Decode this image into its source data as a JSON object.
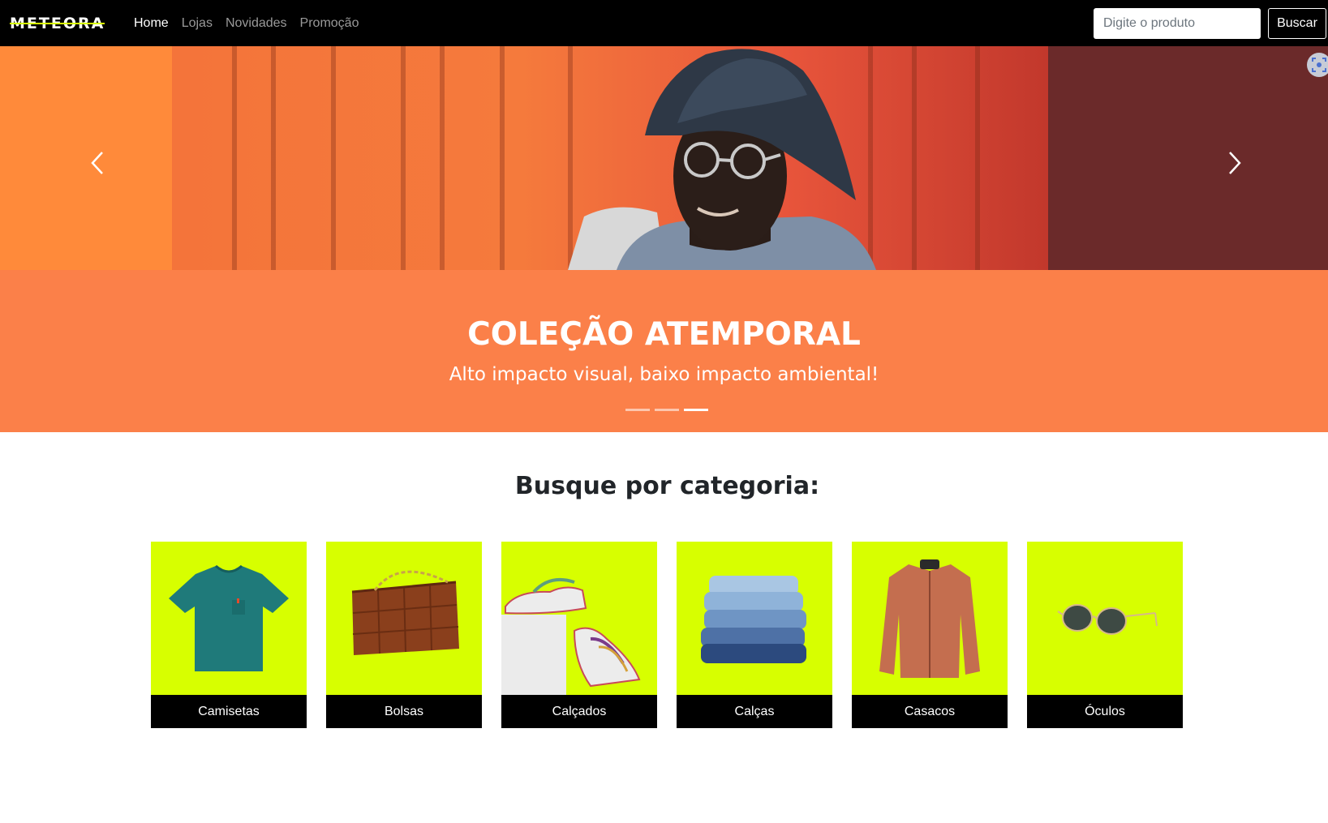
{
  "brand": {
    "logo_text": "METEORA",
    "accent_color": "#d7ff00"
  },
  "nav": {
    "links": [
      {
        "label": "Home",
        "active": true
      },
      {
        "label": "Lojas",
        "active": false
      },
      {
        "label": "Novidades",
        "active": false
      },
      {
        "label": "Promoção",
        "active": false
      }
    ]
  },
  "search": {
    "placeholder": "Digite o produto",
    "value": "",
    "button_label": "Buscar"
  },
  "hero": {
    "title": "COLEÇÃO ATEMPORAL",
    "subtitle": "Alto impacto visual, baixo impacto ambiental!",
    "slide_count": 3,
    "active_slide": 3,
    "prev_icon": "chevron-left-icon",
    "next_icon": "chevron-right-icon",
    "caption_color": "#fb8049"
  },
  "categories": {
    "title": "Busque por categoria:",
    "card_color": "#d7ff00",
    "items": [
      {
        "label": "Camisetas",
        "icon": "tshirt-icon"
      },
      {
        "label": "Bolsas",
        "icon": "bag-icon"
      },
      {
        "label": "Calçados",
        "icon": "sneakers-icon"
      },
      {
        "label": "Calças",
        "icon": "jeans-icon"
      },
      {
        "label": "Casacos",
        "icon": "jacket-icon"
      },
      {
        "label": "Óculos",
        "icon": "sunglasses-icon"
      }
    ]
  }
}
